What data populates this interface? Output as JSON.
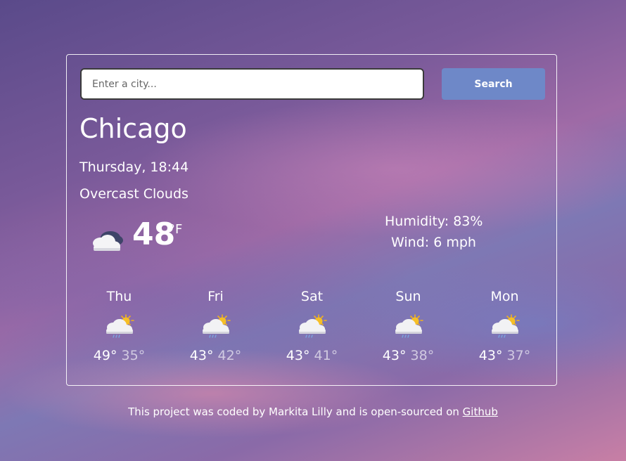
{
  "search": {
    "placeholder": "Enter a city...",
    "button_label": "Search"
  },
  "current": {
    "city": "Chicago",
    "date": "Thursday, 18:44",
    "description": "Overcast Clouds",
    "temperature": "48",
    "unit": "°F",
    "humidity": "Humidity: 83%",
    "wind": "Wind: 6 mph",
    "icon": "overcast-clouds-icon"
  },
  "forecast": [
    {
      "day": "Thu",
      "max": "49°",
      "min": "35°",
      "icon": "sun-cloud-rain-icon"
    },
    {
      "day": "Fri",
      "max": "43°",
      "min": "42°",
      "icon": "sun-cloud-rain-icon"
    },
    {
      "day": "Sat",
      "max": "43°",
      "min": "41°",
      "icon": "sun-cloud-rain-icon"
    },
    {
      "day": "Sun",
      "max": "43°",
      "min": "38°",
      "icon": "sun-cloud-rain-icon"
    },
    {
      "day": "Mon",
      "max": "43°",
      "min": "37°",
      "icon": "sun-cloud-rain-icon"
    }
  ],
  "footer": {
    "text": "This project was coded by Markita Lilly and is open-sourced on ",
    "link_label": "Github"
  }
}
